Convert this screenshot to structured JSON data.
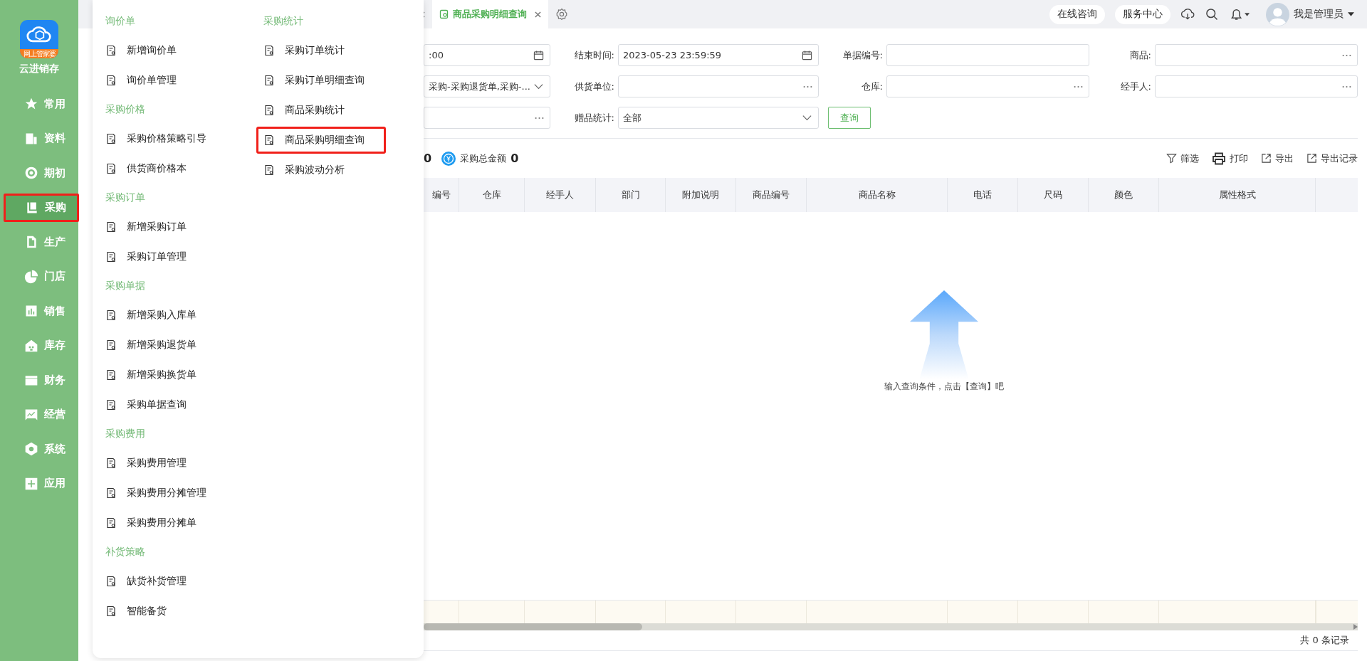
{
  "app": {
    "logo_badge": "网上管家婆",
    "name": "云进销存"
  },
  "nav": [
    {
      "label": "常用",
      "kind": "star",
      "selected": false,
      "highlighted": false
    },
    {
      "label": "资料",
      "kind": "doc",
      "selected": false,
      "highlighted": false
    },
    {
      "label": "期初",
      "kind": "target",
      "selected": false,
      "highlighted": false
    },
    {
      "label": "采购",
      "kind": "book",
      "selected": true,
      "highlighted": true
    },
    {
      "label": "生产",
      "kind": "file",
      "selected": false,
      "highlighted": false
    },
    {
      "label": "门店",
      "kind": "pie",
      "selected": false,
      "highlighted": false
    },
    {
      "label": "销售",
      "kind": "bars",
      "selected": false,
      "highlighted": false
    },
    {
      "label": "库存",
      "kind": "home",
      "selected": false,
      "highlighted": false
    },
    {
      "label": "财务",
      "kind": "wallet",
      "selected": false,
      "highlighted": false
    },
    {
      "label": "经营",
      "kind": "chart",
      "selected": false,
      "highlighted": false
    },
    {
      "label": "系统",
      "kind": "hex",
      "selected": false,
      "highlighted": false
    },
    {
      "label": "应用",
      "kind": "plus",
      "selected": false,
      "highlighted": false
    }
  ],
  "flyout": {
    "columns": [
      {
        "groups": [
          {
            "title": "询价单",
            "items": [
              {
                "label": "新增询价单",
                "highlighted": false
              },
              {
                "label": "询价单管理",
                "highlighted": false
              }
            ]
          },
          {
            "title": "采购价格",
            "items": [
              {
                "label": "采购价格策略引导",
                "highlighted": false
              },
              {
                "label": "供货商价格本",
                "highlighted": false
              }
            ]
          },
          {
            "title": "采购订单",
            "items": [
              {
                "label": "新增采购订单",
                "highlighted": false
              },
              {
                "label": "采购订单管理",
                "highlighted": false
              }
            ]
          },
          {
            "title": "采购单据",
            "items": [
              {
                "label": "新增采购入库单",
                "highlighted": false
              },
              {
                "label": "新增采购退货单",
                "highlighted": false
              },
              {
                "label": "新增采购换货单",
                "highlighted": false
              },
              {
                "label": "采购单据查询",
                "highlighted": false
              }
            ]
          },
          {
            "title": "采购费用",
            "items": [
              {
                "label": "采购费用管理",
                "highlighted": false
              },
              {
                "label": "采购费用分摊管理",
                "highlighted": false
              },
              {
                "label": "采购费用分摊单",
                "highlighted": false
              }
            ]
          },
          {
            "title": "补货策略",
            "items": [
              {
                "label": "缺货补货管理",
                "highlighted": false
              },
              {
                "label": "智能备货",
                "highlighted": false
              }
            ]
          }
        ]
      },
      {
        "groups": [
          {
            "title": "采购统计",
            "items": [
              {
                "label": "采购订单统计",
                "highlighted": false
              },
              {
                "label": "采购订单明细查询",
                "highlighted": false
              },
              {
                "label": "商品采购统计",
                "highlighted": false
              },
              {
                "label": "商品采购明细查询",
                "highlighted": true
              },
              {
                "label": "采购波动分析",
                "highlighted": false
              }
            ]
          }
        ]
      }
    ]
  },
  "tabs": [
    {
      "label": "商品采购明细查询",
      "selected": true
    }
  ],
  "header": {
    "buttons": [
      "在线咨询",
      "服务中心"
    ],
    "user": "我是管理员"
  },
  "filters": [
    {
      "kind": "date",
      "value": ":00"
    },
    {
      "kind": "date",
      "label": "结束时间:",
      "value": "2023-05-23 23:59:59"
    },
    {
      "kind": "text",
      "label": "单据编号:"
    },
    {
      "kind": "lookup",
      "label": "商品:"
    },
    {
      "kind": "select",
      "value": "采购-采购退货单,采购-..."
    },
    {
      "kind": "lookup",
      "label": "供货单位:"
    },
    {
      "kind": "lookup",
      "label": "仓库:"
    },
    {
      "kind": "lookup",
      "label": "经手人:"
    },
    {
      "kind": "lookup"
    },
    {
      "kind": "select",
      "label": "赠品统计:",
      "value": "全部"
    }
  ],
  "query_button": "查询",
  "summary": [
    {
      "value": "0"
    },
    {
      "label": "采购总金额",
      "value": "0"
    }
  ],
  "actions": [
    {
      "kind": "filter",
      "label": "筛选"
    },
    {
      "kind": "print",
      "label": "打印"
    },
    {
      "kind": "export",
      "label": "导出"
    },
    {
      "kind": "export",
      "label": "导出记录"
    }
  ],
  "table": {
    "columns": [
      "编号",
      "仓库",
      "经手人",
      "部门",
      "附加说明",
      "商品编号",
      "商品名称",
      "电话",
      "尺码",
      "颜色",
      "属性格式"
    ]
  },
  "empty_message": "输入查询条件，点击【查询】吧",
  "record_count": "共 0 条记录"
}
